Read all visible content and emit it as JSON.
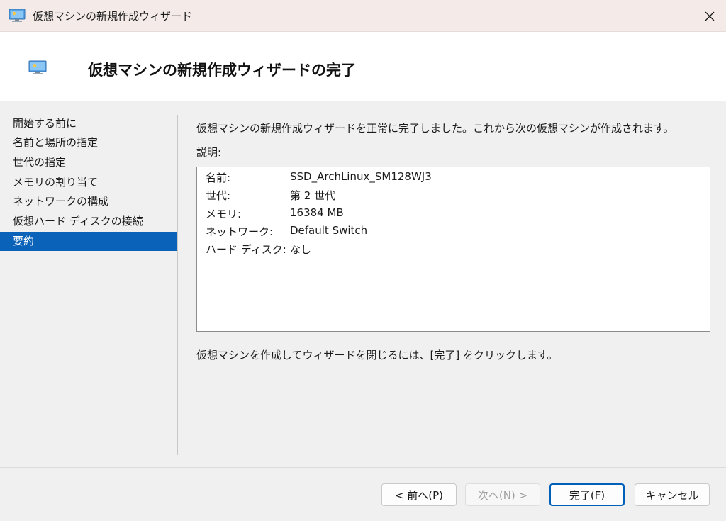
{
  "window": {
    "title": "仮想マシンの新規作成ウィザード",
    "close_icon": "close-icon"
  },
  "header": {
    "title": "仮想マシンの新規作成ウィザードの完了",
    "icon": "virtual-machine-icon"
  },
  "sidebar": {
    "items": [
      {
        "label": "開始する前に",
        "selected": false
      },
      {
        "label": "名前と場所の指定",
        "selected": false
      },
      {
        "label": "世代の指定",
        "selected": false
      },
      {
        "label": "メモリの割り当て",
        "selected": false
      },
      {
        "label": "ネットワークの構成",
        "selected": false
      },
      {
        "label": "仮想ハード ディスクの接続",
        "selected": false
      },
      {
        "label": "要約",
        "selected": true
      }
    ]
  },
  "main": {
    "intro": "仮想マシンの新規作成ウィザードを正常に完了しました。これから次の仮想マシンが作成されます。",
    "description_label": "説明:",
    "summary": [
      {
        "key": "名前:",
        "value": "SSD_ArchLinux_SM128WJ3"
      },
      {
        "key": "世代:",
        "value": "第 2 世代"
      },
      {
        "key": "メモリ:",
        "value": "16384 MB"
      },
      {
        "key": "ネットワーク:",
        "value": "Default Switch"
      },
      {
        "key": "ハード ディスク:",
        "value": "なし"
      }
    ],
    "hint": "仮想マシンを作成してウィザードを閉じるには、[完了] をクリックします。"
  },
  "footer": {
    "back_label": "< 前へ(P)",
    "next_label": "次へ(N) >",
    "finish_label": "完了(F)",
    "cancel_label": "キャンセル"
  },
  "colors": {
    "accent": "#0a63b8",
    "titlebar": "#f4ebe9"
  }
}
